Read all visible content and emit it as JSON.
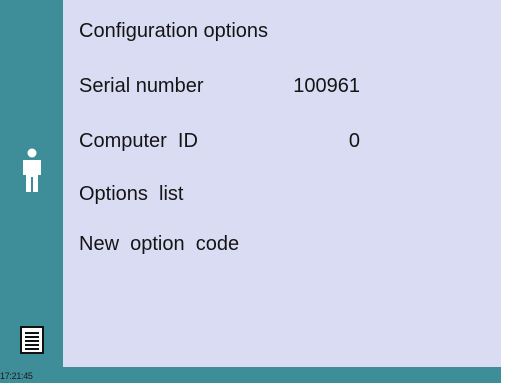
{
  "status_bar": {
    "time": "17:21:45"
  },
  "sidebar": {
    "user_icon": "person-icon",
    "log_icon": "notes-icon"
  },
  "menu": {
    "title": "Configuration options",
    "serial_number_label": "Serial number",
    "serial_number_value": "100961",
    "computer_id_label": "Computer  ID",
    "computer_id_value": "0",
    "options_list_label": "Options  list",
    "new_option_code_label": "New  option  code"
  },
  "colors": {
    "sidebar": "#3e8e9a",
    "panel": "#dadcf4",
    "text": "#141414"
  }
}
